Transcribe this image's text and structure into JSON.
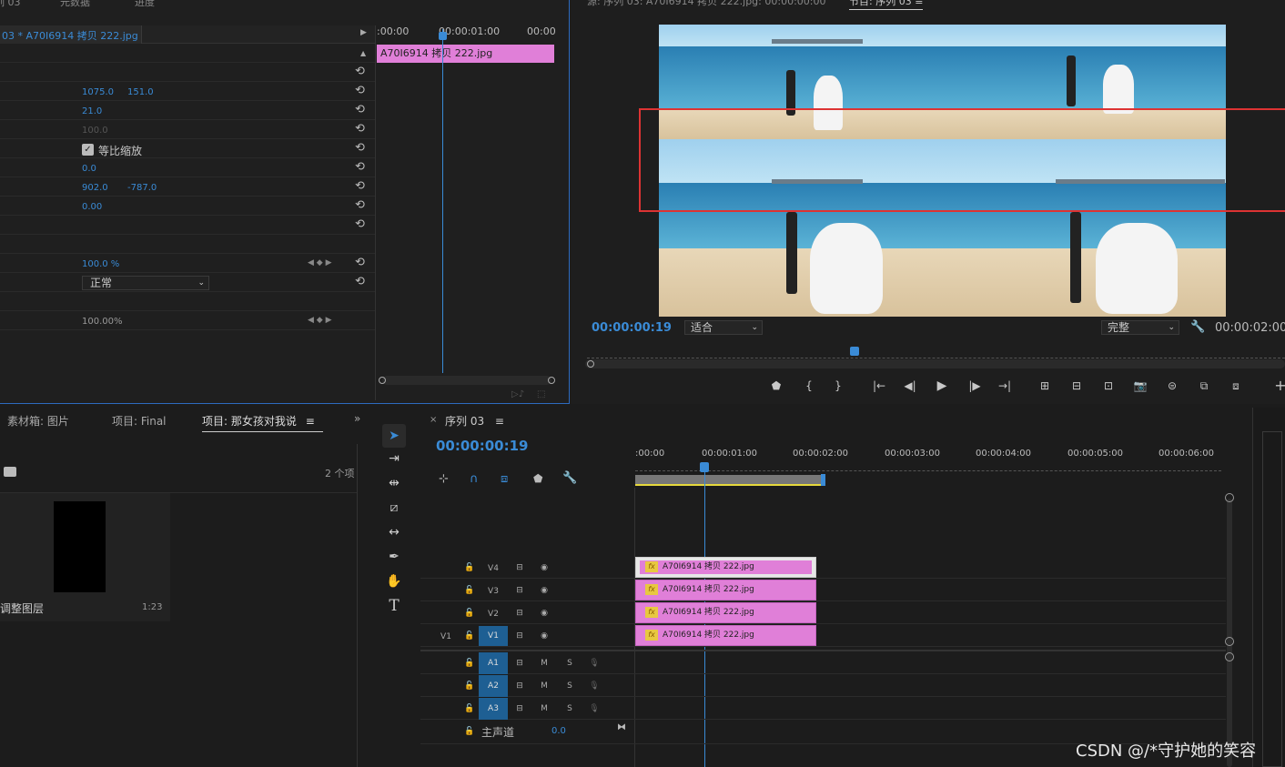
{
  "effect_controls": {
    "top_tabs": [
      "列 03",
      "元数据",
      "进度"
    ],
    "clip_header": "03 * A70I6914 拷贝 222.jpg",
    "ruler": {
      "t0": ":00:00",
      "t1": "00:00:01:00",
      "t2": "00:00"
    },
    "mini_clip": "A70I6914 拷贝 222.jpg",
    "position_x": "1075.0",
    "position_y": "151.0",
    "scale": "21.0",
    "scale_width": "100.0",
    "uniform_scale_label": "等比缩放",
    "rotation": "0.0",
    "anchor_x": "902.0",
    "anchor_y": "-787.0",
    "antiflicker": "0.00",
    "opacity": "100.0 %",
    "blend_mode": "正常",
    "time_remap": "100.00%"
  },
  "program_monitor": {
    "source_label": "源: 序列 03: A70I6914 拷贝 222.jpg: 00:00:00:00",
    "program_tab": "节目: 序列 03",
    "timecode": "00:00:00:19",
    "fit": "适合",
    "quality": "完整",
    "duration": "00:00:02:00"
  },
  "project": {
    "tabs": [
      "素材箱: 图片",
      "项目: Final",
      "项目: 那女孩对我说"
    ],
    "item_count": "2 个项",
    "item_name": "调整图层",
    "item_duration": "1:23"
  },
  "timeline": {
    "sequence_tab": "序列 03",
    "timecode": "00:00:00:19",
    "ruler": [
      ":00:00",
      "00:00:01:00",
      "00:00:02:00",
      "00:00:03:00",
      "00:00:04:00",
      "00:00:05:00",
      "00:00:06:00"
    ],
    "video_tracks": [
      "V4",
      "V3",
      "V2",
      "V1"
    ],
    "audio_tracks": [
      "A1",
      "A2",
      "A3"
    ],
    "clip_label": "A70I6914 拷贝 222.jpg",
    "fx_badge": "fx",
    "master_label": "主声道",
    "master_value": "0.0",
    "source_patch": "V1",
    "m_label": "M",
    "s_label": "S"
  },
  "watermark": "CSDN @/*守护她的笑容"
}
